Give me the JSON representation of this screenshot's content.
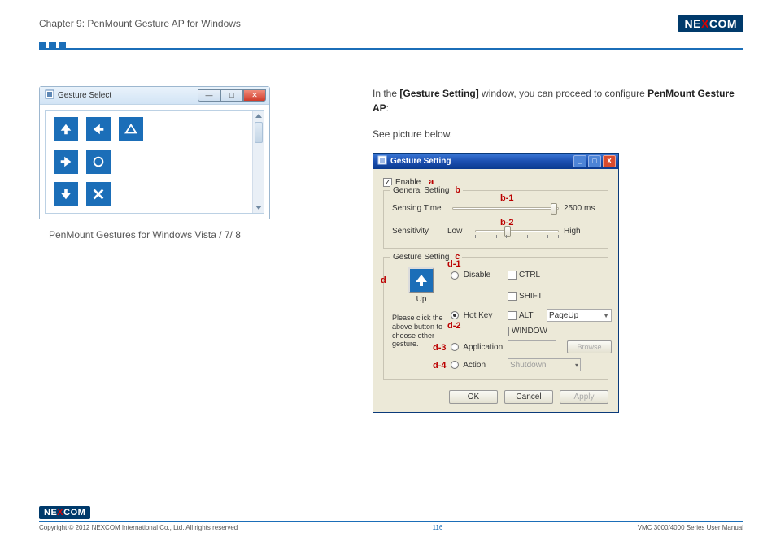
{
  "header": {
    "chapter": "Chapter 9: PenMount Gesture AP for Windows",
    "logo_text": "NEXCOM"
  },
  "left": {
    "gesture_select": {
      "title": "Gesture Select",
      "tiles": [
        {
          "name": "up",
          "svg": "arrow-up"
        },
        {
          "name": "left",
          "svg": "arrow-left"
        },
        {
          "name": "up-stop",
          "svg": "triangle-up"
        },
        {
          "name": "right",
          "svg": "arrow-right"
        },
        {
          "name": "center",
          "svg": "circle"
        },
        {
          "name": "blank",
          "svg": null
        },
        {
          "name": "down",
          "svg": "arrow-down"
        },
        {
          "name": "cancel",
          "svg": "x"
        }
      ]
    },
    "caption": "PenMount Gestures for Windows Vista / 7/ 8"
  },
  "right": {
    "intro_1": "In the ",
    "intro_bold_1": "[Gesture Setting]",
    "intro_2": " window, you can proceed to configure ",
    "intro_bold_2": "PenMount Gesture AP",
    "intro_3": ":",
    "see_picture": "See picture below.",
    "gesture_setting": {
      "title": "Gesture Setting",
      "enable_label": "Enable",
      "enable_checked": true,
      "annotations": {
        "a": "a",
        "b": "b",
        "b1": "b-1",
        "b2": "b-2",
        "c": "c",
        "d": "d",
        "d1": "d-1",
        "d2": "d-2",
        "d3": "d-3",
        "d4": "d-4"
      },
      "general": {
        "legend": "General Setting",
        "sensing_label": "Sensing Time",
        "sensing_value_position": 92,
        "sensing_end": "2500 ms",
        "sensitivity_label": "Sensitivity",
        "sensitivity_low": "Low",
        "sensitivity_high": "High",
        "sensitivity_value_position": 35
      },
      "gesture_group": {
        "legend": "Gesture Setting",
        "up_label": "Up",
        "please_note": "Please click the above button to choose other gesture.",
        "disable_label": "Disable",
        "hotkey_label": "Hot Key",
        "hotkey_selected": true,
        "ctrl": "CTRL",
        "shift": "SHIFT",
        "alt": "ALT",
        "window": "WINDOW",
        "hotkey_value": "PageUp",
        "application_label": "Application",
        "app_value": "",
        "browse_label": "Browse",
        "action_label": "Action",
        "action_value": "Shutdown"
      },
      "buttons": {
        "ok": "OK",
        "cancel": "Cancel",
        "apply": "Apply"
      }
    }
  },
  "footer": {
    "copyright": "Copyright © 2012 NEXCOM International Co., Ltd. All rights reserved",
    "page_number": "116",
    "manual": "VMC 3000/4000 Series User Manual"
  }
}
